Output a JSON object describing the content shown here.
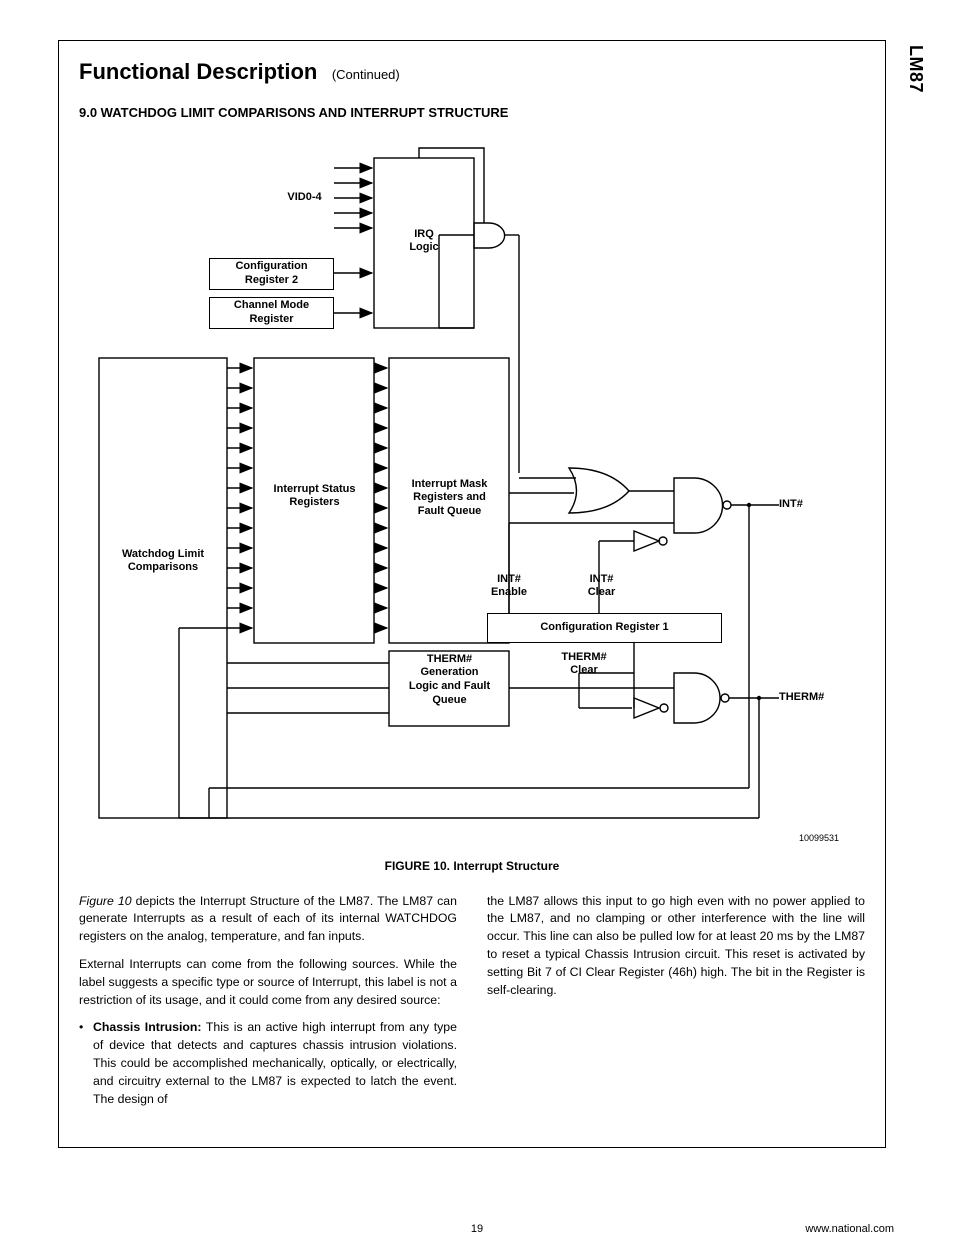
{
  "side_label": "LM87",
  "section_title": "Functional Description",
  "section_continued": "(Continued)",
  "subsection": "9.0 WATCHDOG LIMIT COMPARISONS AND INTERRUPT STRUCTURE",
  "diagram": {
    "vid_label": "VID0-4",
    "irq_logic": "IRQ\nLogic",
    "config_reg2": "Configuration\nRegister 2",
    "channel_mode": "Channel Mode\nRegister",
    "watchdog": "Watchdog Limit\nComparisons",
    "int_status": "Interrupt Status\nRegisters",
    "int_mask": "Interrupt Mask\nRegisters and\nFault Queue",
    "int_enable": "INT#\nEnable",
    "int_clear": "INT#\nClear",
    "config_reg1": "Configuration Register 1",
    "therm_gen": "THERM#\nGeneration\nLogic and Fault\nQueue",
    "therm_clear": "THERM#\nClear",
    "int_out": "INT#",
    "therm_out": "THERM#",
    "img_id": "10099531"
  },
  "figure_caption": "FIGURE 10. Interrupt Structure",
  "body": {
    "p1_a": "Figure 10",
    "p1_b": " depicts the Interrupt Structure of the LM87. The LM87 can generate Interrupts as a result of each of its internal WATCHDOG registers on the analog, temperature, and fan inputs.",
    "p2": "External Interrupts can come from the following sources. While the label suggests a specific type or source of Interrupt, this label is not a restriction of its usage, and it could come from any desired source:",
    "bullet_lead": "Chassis Intrusion:",
    "bullet_rest": "   This is an active high interrupt from any type of device that detects and captures chassis intrusion violations. This could be accomplished mechanically, optically, or electrically, and circuitry external to the LM87 is expected to latch the event. The design of",
    "p3": "the LM87 allows this input to go high even with no power applied to the LM87, and no clamping or other interference with the line will occur. This line can also be pulled low for at least 20 ms by the LM87 to reset a typical Chassis Intrusion circuit. This reset is activated by setting Bit 7 of CI Clear Register (46h) high. The bit in the Register is self-clearing."
  },
  "footer": {
    "page": "19",
    "url": "www.national.com"
  }
}
